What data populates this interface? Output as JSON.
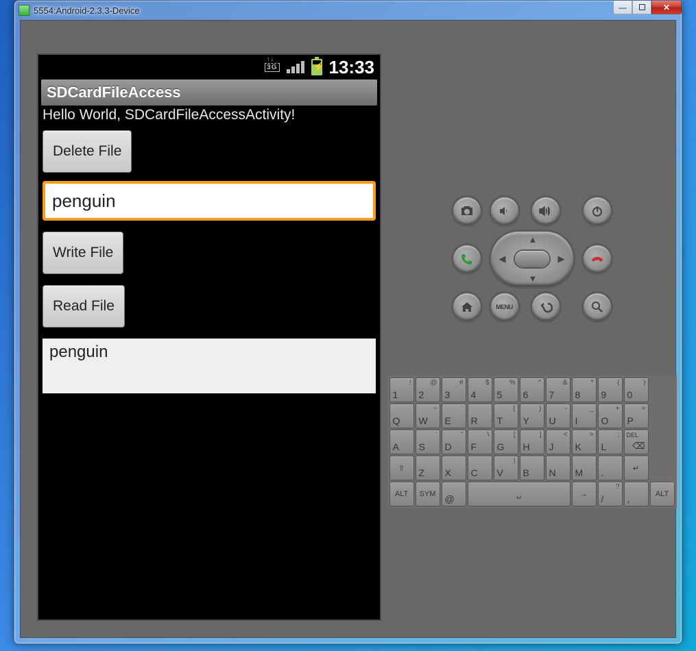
{
  "window": {
    "title": "5554:Android-2.3.3-Device",
    "min_label": "—",
    "max_label": "",
    "close_label": "✕"
  },
  "statusbar": {
    "network": "3G",
    "time": "13:33"
  },
  "app": {
    "title": "SDCardFileAccess",
    "hello_text": "Hello World, SDCardFileAccessActivity!",
    "delete_btn": "Delete File",
    "write_btn": "Write File",
    "read_btn": "Read File",
    "input_value": "penguin",
    "output_value": "penguin"
  },
  "hw_buttons": {
    "camera": "camera-icon",
    "vol_down": "volume-down-icon",
    "vol_up": "volume-up-icon",
    "power": "power-icon",
    "call": "call-icon",
    "endcall": "end-call-icon",
    "home": "home-icon",
    "menu": "MENU",
    "back": "back-icon",
    "search": "search-icon"
  },
  "keyboard": {
    "rows": [
      [
        {
          "m": "1",
          "s": "!"
        },
        {
          "m": "2",
          "s": "@"
        },
        {
          "m": "3",
          "s": "#"
        },
        {
          "m": "4",
          "s": "$"
        },
        {
          "m": "5",
          "s": "%"
        },
        {
          "m": "6",
          "s": "^"
        },
        {
          "m": "7",
          "s": "&"
        },
        {
          "m": "8",
          "s": "*"
        },
        {
          "m": "9",
          "s": "("
        },
        {
          "m": "0",
          "s": ")"
        }
      ],
      [
        {
          "m": "Q"
        },
        {
          "m": "W",
          "s": "~"
        },
        {
          "m": "E",
          "s": "`"
        },
        {
          "m": "R"
        },
        {
          "m": "T",
          "s": "{"
        },
        {
          "m": "Y",
          "s": "}"
        },
        {
          "m": "U",
          "s": "-"
        },
        {
          "m": "I",
          "s": "_"
        },
        {
          "m": "O",
          "s": "+"
        },
        {
          "m": "P",
          "s": "="
        }
      ],
      [
        {
          "m": "A"
        },
        {
          "m": "S",
          "s": "'"
        },
        {
          "m": "D",
          "s": "\""
        },
        {
          "m": "F",
          "s": "\\"
        },
        {
          "m": "G",
          "s": "["
        },
        {
          "m": "H",
          "s": "]"
        },
        {
          "m": "J",
          "s": "<"
        },
        {
          "m": "K",
          "s": ">"
        },
        {
          "m": "L",
          "s": ";"
        },
        {
          "m": "DEL",
          "cls": "small-txt",
          "name": "delete-key",
          "icon": "⌫"
        }
      ],
      [
        {
          "m": "⇧",
          "cls": "small-txt",
          "name": "shift-key"
        },
        {
          "m": "Z"
        },
        {
          "m": "X"
        },
        {
          "m": "C"
        },
        {
          "m": "V",
          "s": "|"
        },
        {
          "m": "B"
        },
        {
          "m": "N"
        },
        {
          "m": "M"
        },
        {
          "m": "."
        },
        {
          "m": "↵",
          "cls": "small-txt",
          "name": "enter-key"
        }
      ],
      [
        {
          "m": "ALT",
          "cls": "small-txt",
          "name": "alt-left-key"
        },
        {
          "m": "SYM",
          "cls": "small-txt",
          "name": "sym-key"
        },
        {
          "m": "@"
        },
        {
          "m": "␣",
          "cls": "space small-txt",
          "name": "space-key"
        },
        {
          "m": "→",
          "cls": "small-txt",
          "name": "arrow-key"
        },
        {
          "m": "/",
          "s": "?"
        },
        {
          "m": ","
        },
        {
          "m": "ALT",
          "cls": "small-txt",
          "name": "alt-right-key"
        }
      ]
    ]
  }
}
